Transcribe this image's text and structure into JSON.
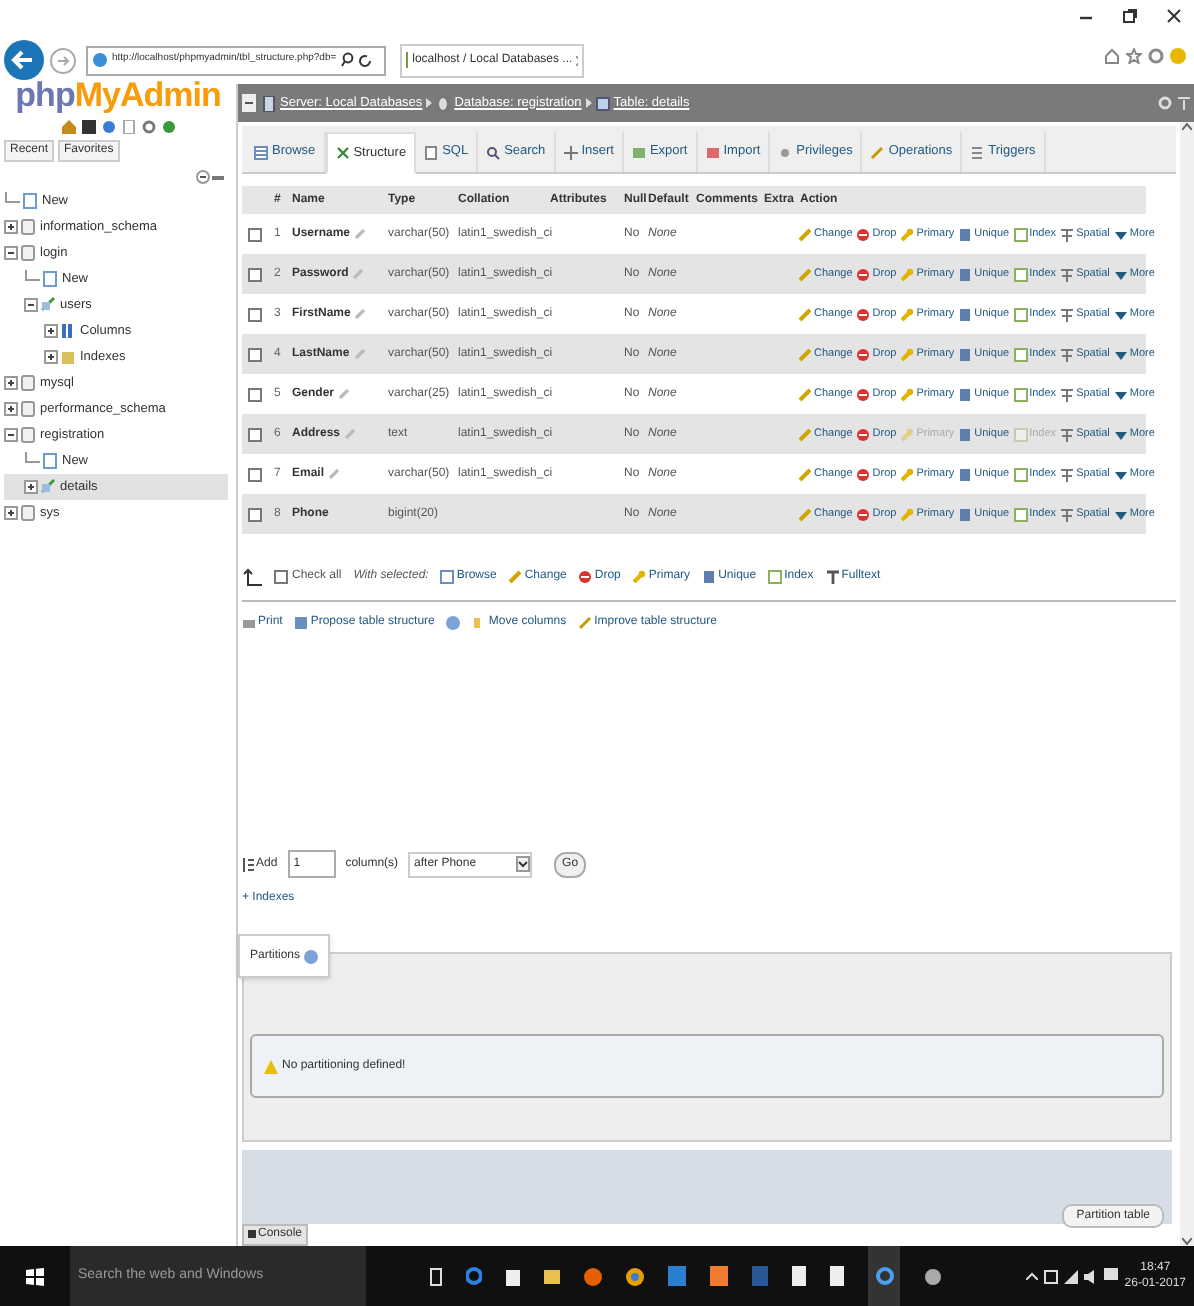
{
  "browser": {
    "address": "http://localhost/phpmyadmin/tbl_structure.php?db=",
    "tab_title": "localhost / Local Databases ..."
  },
  "logo": {
    "part1": "php",
    "part2": "MyAdmin"
  },
  "sidebar": {
    "tabs": [
      "Recent",
      "Favorites"
    ],
    "tree": [
      {
        "kind": "new",
        "label": "New",
        "selected": false
      },
      {
        "kind": "database",
        "label": "information_schema",
        "expanded": false,
        "selected": false
      },
      {
        "kind": "database",
        "label": "login",
        "expanded": true,
        "selected": false,
        "children": [
          {
            "kind": "new",
            "label": "New",
            "selected": false
          },
          {
            "kind": "table",
            "label": "users",
            "expanded": true,
            "selected": false,
            "children": [
              {
                "kind": "columns",
                "label": "Columns",
                "expanded": false,
                "selected": false
              },
              {
                "kind": "indexes",
                "label": "Indexes",
                "expanded": false,
                "selected": false
              }
            ]
          }
        ]
      },
      {
        "kind": "database",
        "label": "mysql",
        "expanded": false,
        "selected": false
      },
      {
        "kind": "database",
        "label": "performance_schema",
        "expanded": false,
        "selected": false
      },
      {
        "kind": "database",
        "label": "registration",
        "expanded": true,
        "selected": false,
        "children": [
          {
            "kind": "new",
            "label": "New",
            "selected": false
          },
          {
            "kind": "table",
            "label": "details",
            "expanded": false,
            "selected": true
          }
        ]
      },
      {
        "kind": "database",
        "label": "sys",
        "expanded": false,
        "selected": false
      }
    ]
  },
  "breadcrumb": [
    {
      "kind": "server",
      "label": "Server: Local Databases"
    },
    {
      "kind": "database",
      "label": "Database: registration"
    },
    {
      "kind": "table",
      "label": "Table: details"
    }
  ],
  "tabs": [
    {
      "kind": "browse",
      "label": "Browse",
      "selected": false
    },
    {
      "kind": "structure",
      "label": "Structure",
      "selected": true
    },
    {
      "kind": "sql",
      "label": "SQL",
      "selected": false
    },
    {
      "kind": "search",
      "label": "Search",
      "selected": false
    },
    {
      "kind": "insert",
      "label": "Insert",
      "selected": false
    },
    {
      "kind": "export",
      "label": "Export",
      "selected": false
    },
    {
      "kind": "import",
      "label": "Import",
      "selected": false
    },
    {
      "kind": "privileges",
      "label": "Privileges",
      "selected": false
    },
    {
      "kind": "operations",
      "label": "Operations",
      "selected": false
    },
    {
      "kind": "triggers",
      "label": "Triggers",
      "selected": false
    }
  ],
  "table": {
    "columns": [
      "#",
      "Name",
      "Type",
      "Collation",
      "Attributes",
      "Null",
      "Default",
      "Comments",
      "Extra",
      "Action"
    ],
    "rows": [
      {
        "checked": false,
        "num": "1",
        "name": "Username",
        "icon": true,
        "type": "varchar(50)",
        "collation": "latin1_swedish_ci",
        "null": "No",
        "default": "None",
        "actions": [
          {
            "kind": "change",
            "label": "Change",
            "disabled": false
          },
          {
            "kind": "drop",
            "label": "Drop",
            "disabled": false
          },
          {
            "kind": "primary",
            "label": "Primary",
            "disabled": false
          },
          {
            "kind": "unique",
            "label": "Unique",
            "disabled": false
          },
          {
            "kind": "index",
            "label": "Index",
            "disabled": false
          },
          {
            "kind": "spatial",
            "label": "Spatial",
            "disabled": false
          },
          {
            "kind": "more",
            "label": "More",
            "disabled": false
          }
        ]
      },
      {
        "checked": false,
        "num": "2",
        "name": "Password",
        "icon": true,
        "type": "varchar(50)",
        "collation": "latin1_swedish_ci",
        "null": "No",
        "default": "None",
        "actions": [
          {
            "kind": "change",
            "label": "Change",
            "disabled": false
          },
          {
            "kind": "drop",
            "label": "Drop",
            "disabled": false
          },
          {
            "kind": "primary",
            "label": "Primary",
            "disabled": false
          },
          {
            "kind": "unique",
            "label": "Unique",
            "disabled": false
          },
          {
            "kind": "index",
            "label": "Index",
            "disabled": false
          },
          {
            "kind": "spatial",
            "label": "Spatial",
            "disabled": false
          },
          {
            "kind": "more",
            "label": "More",
            "disabled": false
          }
        ]
      },
      {
        "checked": false,
        "num": "3",
        "name": "FirstName",
        "icon": true,
        "type": "varchar(50)",
        "collation": "latin1_swedish_ci",
        "null": "No",
        "default": "None",
        "actions": [
          {
            "kind": "change",
            "label": "Change",
            "disabled": false
          },
          {
            "kind": "drop",
            "label": "Drop",
            "disabled": false
          },
          {
            "kind": "primary",
            "label": "Primary",
            "disabled": false
          },
          {
            "kind": "unique",
            "label": "Unique",
            "disabled": false
          },
          {
            "kind": "index",
            "label": "Index",
            "disabled": false
          },
          {
            "kind": "spatial",
            "label": "Spatial",
            "disabled": false
          },
          {
            "kind": "more",
            "label": "More",
            "disabled": false
          }
        ]
      },
      {
        "checked": false,
        "num": "4",
        "name": "LastName",
        "icon": true,
        "type": "varchar(50)",
        "collation": "latin1_swedish_ci",
        "null": "No",
        "default": "None",
        "actions": [
          {
            "kind": "change",
            "label": "Change",
            "disabled": false
          },
          {
            "kind": "drop",
            "label": "Drop",
            "disabled": false
          },
          {
            "kind": "primary",
            "label": "Primary",
            "disabled": false
          },
          {
            "kind": "unique",
            "label": "Unique",
            "disabled": false
          },
          {
            "kind": "index",
            "label": "Index",
            "disabled": false
          },
          {
            "kind": "spatial",
            "label": "Spatial",
            "disabled": false
          },
          {
            "kind": "more",
            "label": "More",
            "disabled": false
          }
        ]
      },
      {
        "checked": false,
        "num": "5",
        "name": "Gender",
        "icon": true,
        "type": "varchar(25)",
        "collation": "latin1_swedish_ci",
        "null": "No",
        "default": "None",
        "actions": [
          {
            "kind": "change",
            "label": "Change",
            "disabled": false
          },
          {
            "kind": "drop",
            "label": "Drop",
            "disabled": false
          },
          {
            "kind": "primary",
            "label": "Primary",
            "disabled": false
          },
          {
            "kind": "unique",
            "label": "Unique",
            "disabled": false
          },
          {
            "kind": "index",
            "label": "Index",
            "disabled": false
          },
          {
            "kind": "spatial",
            "label": "Spatial",
            "disabled": false
          },
          {
            "kind": "more",
            "label": "More",
            "disabled": false
          }
        ]
      },
      {
        "checked": false,
        "num": "6",
        "name": "Address",
        "icon": true,
        "type": "text",
        "collation": "latin1_swedish_ci",
        "null": "No",
        "default": "None",
        "actions": [
          {
            "kind": "change",
            "label": "Change",
            "disabled": false
          },
          {
            "kind": "drop",
            "label": "Drop",
            "disabled": false
          },
          {
            "kind": "primary",
            "label": "Primary",
            "disabled": true
          },
          {
            "kind": "unique",
            "label": "Unique",
            "disabled": false
          },
          {
            "kind": "index",
            "label": "Index",
            "disabled": true
          },
          {
            "kind": "spatial",
            "label": "Spatial",
            "disabled": false
          },
          {
            "kind": "more",
            "label": "More",
            "disabled": false
          }
        ]
      },
      {
        "checked": false,
        "num": "7",
        "name": "Email",
        "icon": true,
        "type": "varchar(50)",
        "collation": "latin1_swedish_ci",
        "null": "No",
        "default": "None",
        "actions": [
          {
            "kind": "change",
            "label": "Change",
            "disabled": false
          },
          {
            "kind": "drop",
            "label": "Drop",
            "disabled": false
          },
          {
            "kind": "primary",
            "label": "Primary",
            "disabled": false
          },
          {
            "kind": "unique",
            "label": "Unique",
            "disabled": false
          },
          {
            "kind": "index",
            "label": "Index",
            "disabled": false
          },
          {
            "kind": "spatial",
            "label": "Spatial",
            "disabled": false
          },
          {
            "kind": "more",
            "label": "More",
            "disabled": false
          }
        ]
      },
      {
        "checked": false,
        "num": "8",
        "name": "Phone",
        "icon": false,
        "type": "bigint(20)",
        "null": "No",
        "default": "None",
        "actions": [
          {
            "kind": "change",
            "label": "Change",
            "disabled": false
          },
          {
            "kind": "drop",
            "label": "Drop",
            "disabled": false
          },
          {
            "kind": "primary",
            "label": "Primary",
            "disabled": false
          },
          {
            "kind": "unique",
            "label": "Unique",
            "disabled": false
          },
          {
            "kind": "index",
            "label": "Index",
            "disabled": false
          },
          {
            "kind": "spatial",
            "label": "Spatial",
            "disabled": false
          },
          {
            "kind": "more",
            "label": "More",
            "disabled": false
          }
        ]
      }
    ]
  },
  "bulk": {
    "check_all": "Check all",
    "checked": false,
    "with_selected": "With selected:",
    "actions": [
      {
        "kind": "browse",
        "label": "Browse"
      },
      {
        "kind": "change",
        "label": "Change"
      },
      {
        "kind": "drop",
        "label": "Drop"
      },
      {
        "kind": "primary",
        "label": "Primary"
      },
      {
        "kind": "unique",
        "label": "Unique"
      },
      {
        "kind": "index",
        "label": "Index"
      },
      {
        "kind": "fulltext",
        "label": "Fulltext"
      }
    ]
  },
  "links": [
    {
      "kind": "print",
      "label": "Print"
    },
    {
      "kind": "propose",
      "label": "Propose table structure"
    },
    {
      "kind": "move",
      "label": "Move columns"
    },
    {
      "kind": "improve",
      "label": "Improve table structure"
    }
  ],
  "add_column": {
    "label": "Add",
    "count": "1",
    "unit": "column(s)",
    "position": "after Phone",
    "button": "Go"
  },
  "indexes_link": "+ Indexes",
  "partitions": {
    "legend": "Partitions",
    "message": "No partitioning defined!",
    "button": "Partition table"
  },
  "console": "Console",
  "taskbar": {
    "search_placeholder": "Search the web and Windows",
    "time": "18:47",
    "date": "26-01-2017"
  }
}
